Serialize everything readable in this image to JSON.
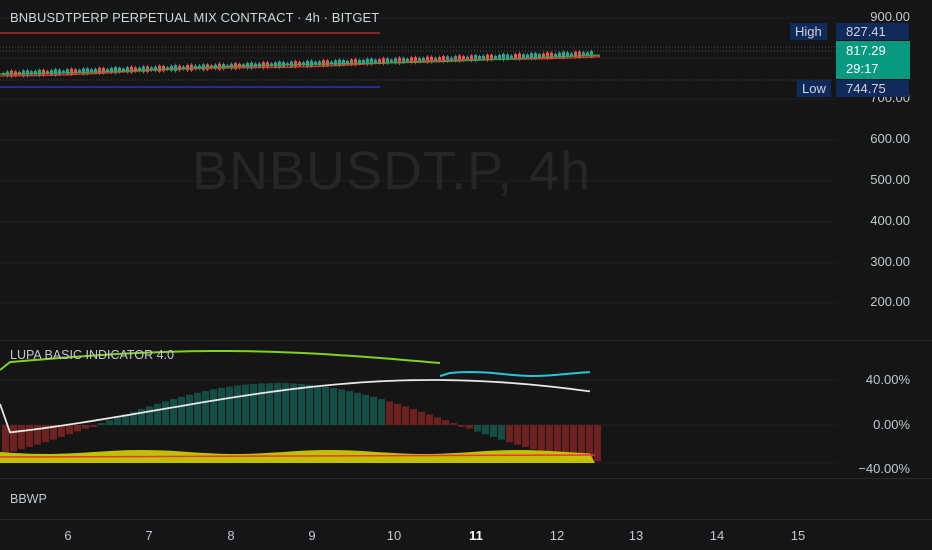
{
  "chart": {
    "title": "BNBUSDTPERP PERPETUAL MIX CONTRACT · 4h · BITGET",
    "watermark": "BNBUSDT.P, 4h",
    "high_label": "High",
    "high_value": "827.41",
    "current_price": "817.29",
    "countdown": "29:17",
    "low_label": "Low",
    "low_value": "744.75",
    "price_ticks": [
      "900.00",
      "700.00",
      "600.00",
      "500.00",
      "400.00",
      "300.00",
      "200.00"
    ]
  },
  "oscillator": {
    "label": "LUPA BASIC INDICATOR 4.0",
    "ticks": [
      "40.00%",
      "0.00%",
      "−40.00%"
    ]
  },
  "bbwp": {
    "label": "BBWP"
  },
  "time_axis": [
    "6",
    "7",
    "8",
    "9",
    "10",
    "11",
    "12",
    "13",
    "14",
    "15"
  ],
  "colors": {
    "bull": "#26a69a",
    "bear": "#ef5350",
    "background": "#151515",
    "tag_blue": "#102a5a",
    "price_tag": "#089981"
  }
}
